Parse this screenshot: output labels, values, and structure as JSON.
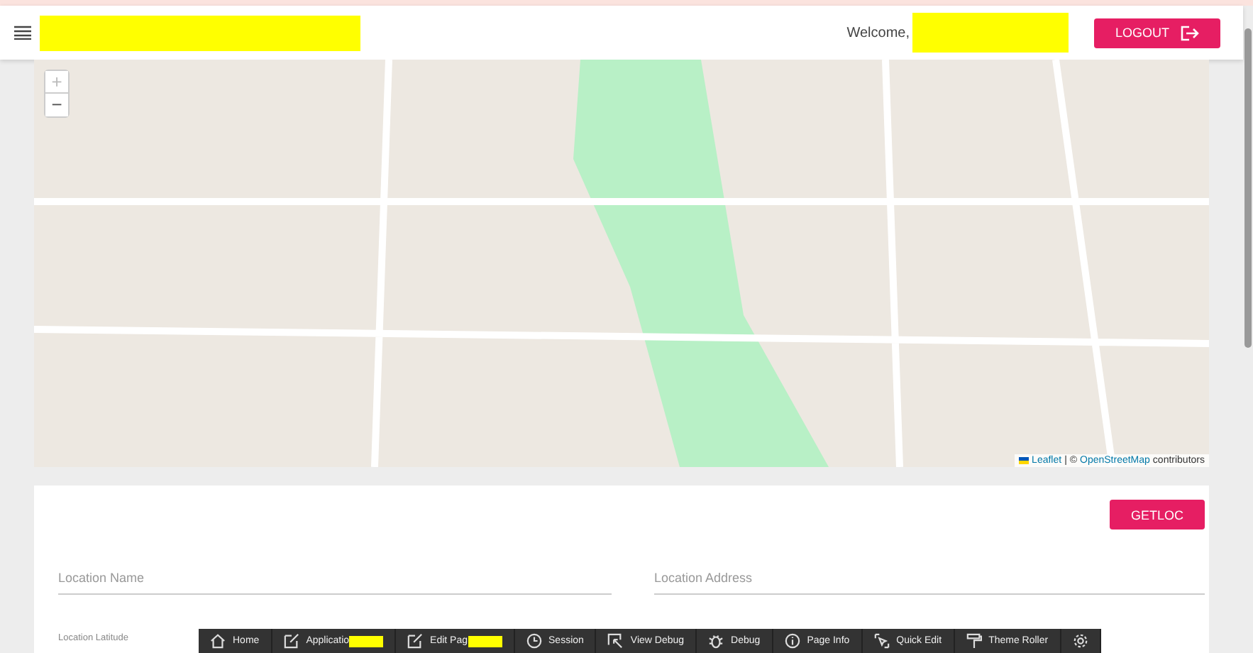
{
  "header": {
    "welcome": "Welcome,",
    "logout": "LOGOUT"
  },
  "map": {
    "zoom_in": "+",
    "zoom_out": "−",
    "attribution": {
      "leaflet": "Leaflet",
      "separator": "| ©",
      "osm": "OpenStreetMap",
      "suffix": "contributors"
    }
  },
  "form": {
    "getloc": "GETLOC",
    "fields": [
      {
        "placeholder": "Location Name"
      },
      {
        "placeholder": "Location Address"
      }
    ],
    "latitude_label": "Location Latitude"
  },
  "dev_toolbar": [
    {
      "label": "Home",
      "kind": "home",
      "redacted": false
    },
    {
      "label": "Applicatio",
      "kind": "edit",
      "redacted": true
    },
    {
      "label": "Edit Pag",
      "kind": "edit",
      "redacted": true
    },
    {
      "label": "Session",
      "kind": "clock",
      "redacted": false
    },
    {
      "label": "View Debug",
      "kind": "view",
      "redacted": false
    },
    {
      "label": "Debug",
      "kind": "bug",
      "redacted": false
    },
    {
      "label": "Page Info",
      "kind": "info",
      "redacted": false
    },
    {
      "label": "Quick Edit",
      "kind": "cursor",
      "redacted": false
    },
    {
      "label": "Theme Roller",
      "kind": "roller",
      "redacted": false
    },
    {
      "kind": "gear",
      "redacted": false
    }
  ]
}
